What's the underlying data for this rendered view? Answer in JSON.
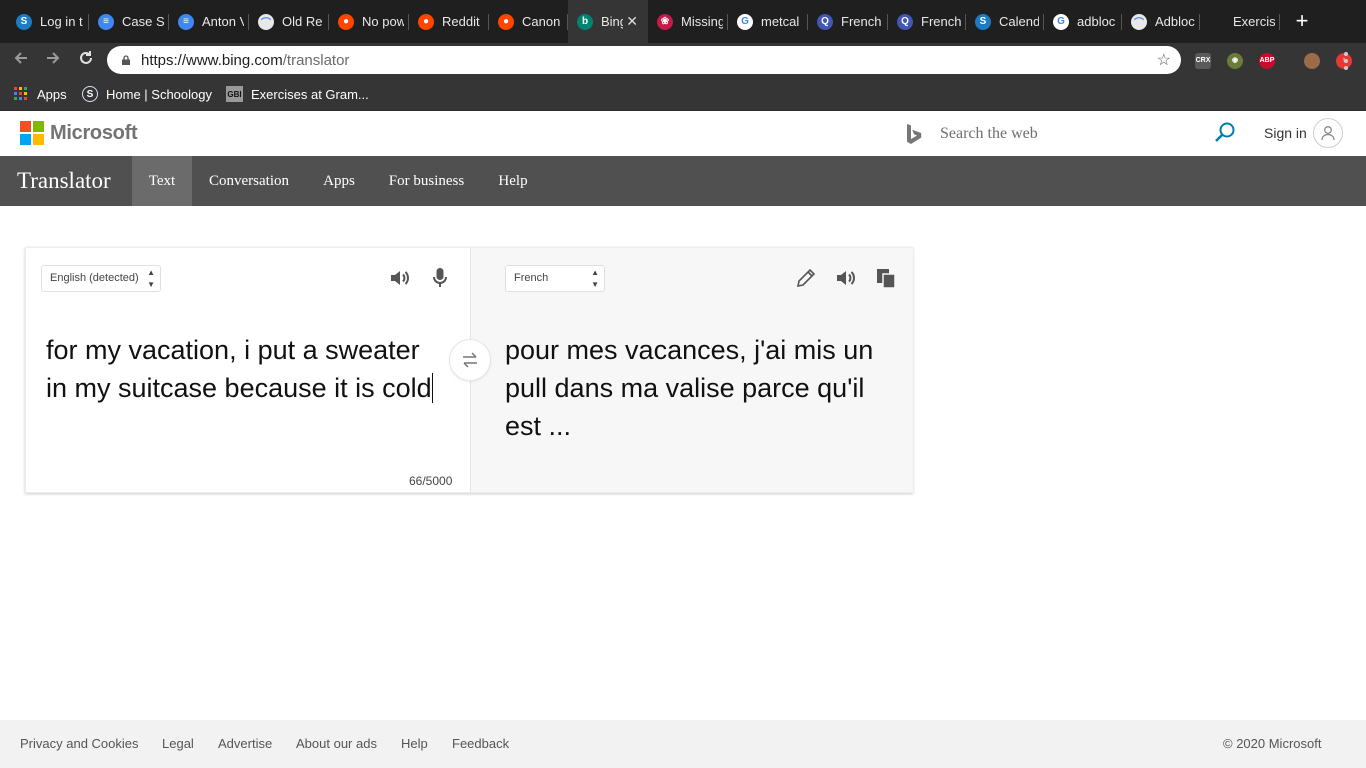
{
  "browser": {
    "tabs": [
      {
        "title": "Log in t",
        "icon": "schoology-icon",
        "color": "#1b7bc4",
        "glyph": "S"
      },
      {
        "title": "Case S",
        "icon": "google-docs-icon",
        "color": "#4285f4",
        "glyph": "≡"
      },
      {
        "title": "Anton V",
        "icon": "google-docs-icon",
        "color": "#4285f4",
        "glyph": "≡"
      },
      {
        "title": "Old Re",
        "icon": "rainbow-icon",
        "color": "#e8e8e8",
        "glyph": "⌒"
      },
      {
        "title": "No pow",
        "icon": "reddit-icon",
        "color": "#ff4500",
        "glyph": "●"
      },
      {
        "title": "Reddit",
        "icon": "reddit-icon",
        "color": "#ff4500",
        "glyph": "●"
      },
      {
        "title": "Canon",
        "icon": "reddit-icon",
        "color": "#ff4500",
        "glyph": "●"
      },
      {
        "title": "Bing",
        "icon": "bing-icon",
        "color": "#008373",
        "glyph": "b",
        "active": true
      },
      {
        "title": "Missing",
        "icon": "raspberry-icon",
        "color": "#c51a4a",
        "glyph": "❀"
      },
      {
        "title": "metcal",
        "icon": "google-icon",
        "color": "#ffffff",
        "glyph": "G"
      },
      {
        "title": "French",
        "icon": "quizlet-icon",
        "color": "#4257b2",
        "glyph": "Q"
      },
      {
        "title": "French",
        "icon": "quizlet-icon",
        "color": "#4257b2",
        "glyph": "Q"
      },
      {
        "title": "Calend",
        "icon": "schoology-icon",
        "color": "#1b7bc4",
        "glyph": "S"
      },
      {
        "title": "adbloc",
        "icon": "google-icon",
        "color": "#ffffff",
        "glyph": "G"
      },
      {
        "title": "Adbloc",
        "icon": "rainbow-icon",
        "color": "#e8e8e8",
        "glyph": "⌒"
      },
      {
        "title": "Exercis",
        "icon": "blank-icon",
        "color": "#1f1f1f",
        "glyph": ""
      }
    ],
    "url_host": "https://www.bing.com",
    "url_path": "/translator",
    "bookmarks": [
      {
        "label": "Apps",
        "icon": "apps-grid-icon"
      },
      {
        "label": "Home | Schoology",
        "icon": "schoology-icon"
      },
      {
        "label": "Exercises at Gram...",
        "icon": "gbi-icon"
      }
    ],
    "extensions": [
      {
        "name": "crx-icon",
        "text": "CRX",
        "color": "#5a5a5a"
      },
      {
        "name": "owl-icon",
        "text": "◉",
        "color": "#6b7b3a"
      },
      {
        "name": "adblock-plus-icon",
        "text": "ABP",
        "color": "#c70d2c"
      },
      {
        "name": "profile-photo-icon",
        "text": "",
        "color": "#9b6b4b"
      },
      {
        "name": "update-icon",
        "text": "↑",
        "color": "#e53935"
      }
    ]
  },
  "header": {
    "brand": "Microsoft",
    "search_placeholder": "Search the web",
    "signin": "Sign in"
  },
  "translator_nav": {
    "brand": "Translator",
    "items": [
      "Text",
      "Conversation",
      "Apps",
      "For business",
      "Help"
    ],
    "active": "Text"
  },
  "translator": {
    "source_language": "English (detected)",
    "target_language": "French",
    "source_text": "for my vacation, i put a sweater in my suitcase because it is cold",
    "target_text": "pour mes vacances, j'ai mis un pull dans ma valise parce qu'il est  ...",
    "char_count": "66/5000"
  },
  "footer": {
    "links": [
      "Privacy and Cookies",
      "Legal",
      "Advertise",
      "About our ads",
      "Help",
      "Feedback"
    ],
    "copyright": "© 2020 Microsoft"
  }
}
